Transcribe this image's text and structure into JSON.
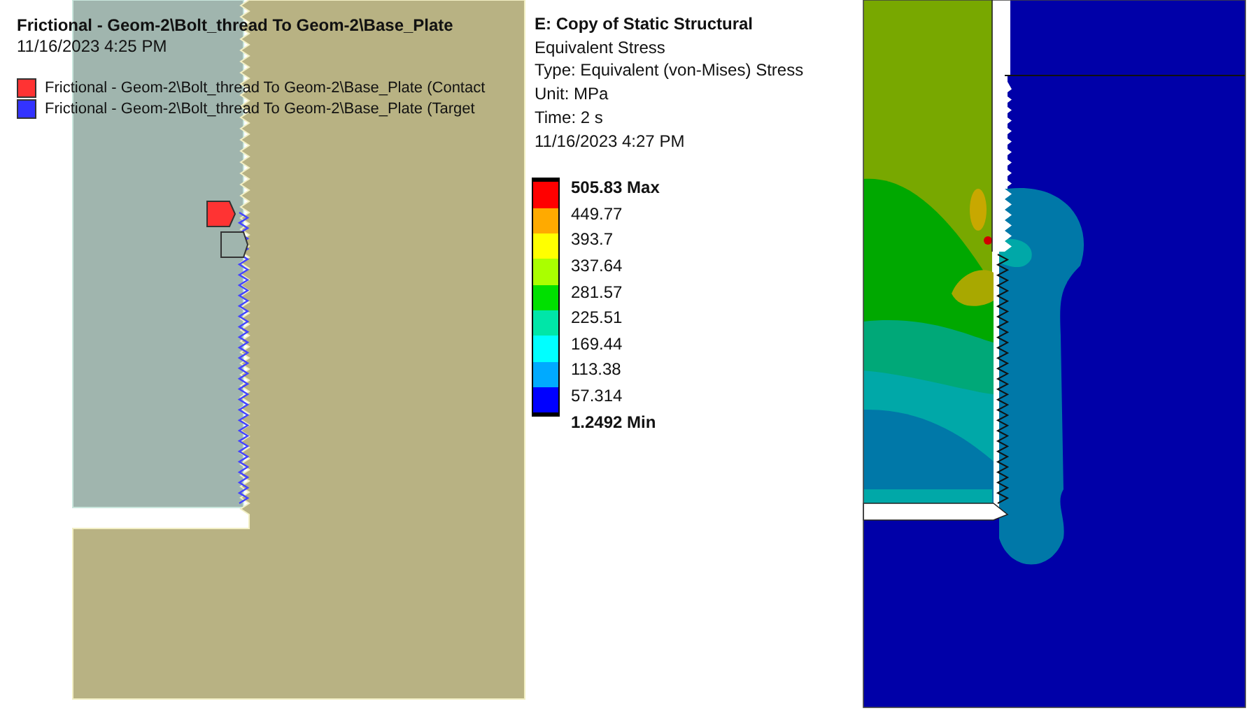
{
  "contact_view": {
    "title": "Frictional - Geom-2\\Bolt_thread To Geom-2\\Base_Plate",
    "timestamp": "11/16/2023 4:25 PM",
    "legend": [
      {
        "label": "Frictional - Geom-2\\Bolt_thread To Geom-2\\Base_Plate (Contact",
        "color": "#ff3333"
      },
      {
        "label": "Frictional - Geom-2\\Bolt_thread To Geom-2\\Base_Plate (Target",
        "color": "#3333ff"
      }
    ]
  },
  "result": {
    "title": "E: Copy of Static Structural",
    "lines": [
      "Equivalent Stress",
      "Type: Equivalent (von-Mises) Stress",
      "Unit: MPa",
      "Time: 2 s",
      "11/16/2023 4:27 PM"
    ],
    "bands": [
      {
        "color": "#ff0000"
      },
      {
        "color": "#ffaa00"
      },
      {
        "color": "#ffff00"
      },
      {
        "color": "#aaff00"
      },
      {
        "color": "#00e000"
      },
      {
        "color": "#00e6a8"
      },
      {
        "color": "#00ffff"
      },
      {
        "color": "#00aaff"
      },
      {
        "color": "#0000ff"
      }
    ],
    "labels": [
      {
        "text": "505.83 Max",
        "kind": "extreme"
      },
      {
        "text": "449.77",
        "kind": "value"
      },
      {
        "text": "393.7",
        "kind": "value"
      },
      {
        "text": "337.64",
        "kind": "value"
      },
      {
        "text": "281.57",
        "kind": "value"
      },
      {
        "text": "225.51",
        "kind": "value"
      },
      {
        "text": "169.44",
        "kind": "value"
      },
      {
        "text": "113.38",
        "kind": "value"
      },
      {
        "text": "57.314",
        "kind": "value"
      },
      {
        "text": "1.2492 Min",
        "kind": "extreme"
      }
    ]
  }
}
